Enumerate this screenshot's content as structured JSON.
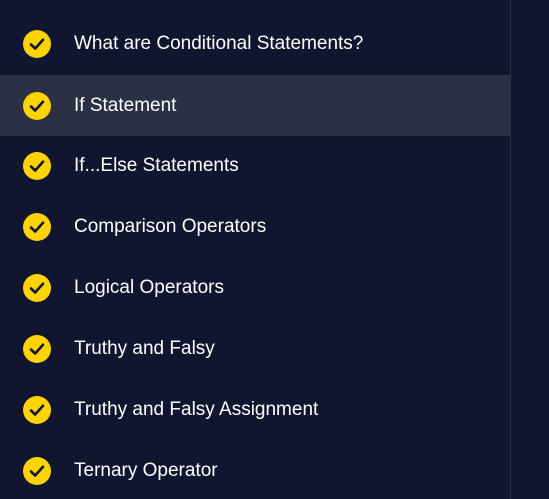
{
  "colors": {
    "background": "#10162f",
    "active_row": "#2a3144",
    "check_fill": "#ffd300",
    "check_mark": "#10162f",
    "text": "#ffffff"
  },
  "sidebar": {
    "items": [
      {
        "label": "What are Conditional Statements?",
        "status": "completed",
        "icon": "check-circle-icon",
        "active": false
      },
      {
        "label": "If Statement",
        "status": "completed",
        "icon": "check-circle-icon",
        "active": true
      },
      {
        "label": "If...Else Statements",
        "status": "completed",
        "icon": "check-circle-icon",
        "active": false
      },
      {
        "label": "Comparison Operators",
        "status": "completed",
        "icon": "check-circle-icon",
        "active": false
      },
      {
        "label": "Logical Operators",
        "status": "completed",
        "icon": "check-circle-icon",
        "active": false
      },
      {
        "label": "Truthy and Falsy",
        "status": "completed",
        "icon": "check-circle-icon",
        "active": false
      },
      {
        "label": "Truthy and Falsy Assignment",
        "status": "completed",
        "icon": "check-circle-icon",
        "active": false
      },
      {
        "label": "Ternary Operator",
        "status": "completed",
        "icon": "check-circle-icon",
        "active": false
      }
    ]
  }
}
